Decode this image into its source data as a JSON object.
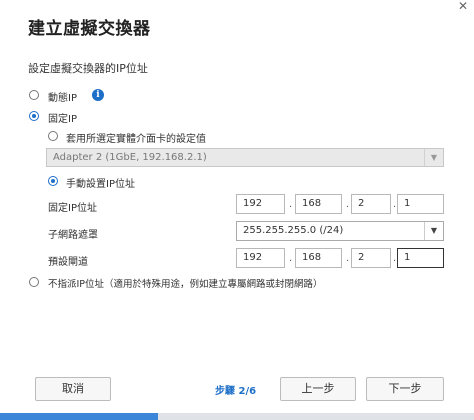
{
  "window": {
    "close_glyph": "✕"
  },
  "header": {
    "title": "建立虛擬交換器",
    "subtitle": "設定虛擬交換器的IP位址"
  },
  "options": {
    "dhcp": {
      "label": "動態IP",
      "info_glyph": "i",
      "checked": false
    },
    "static": {
      "label": "固定IP",
      "checked": true
    },
    "use_adapter": {
      "label": "套用所選定實體介面卡的設定值",
      "checked": false
    },
    "adapter_select": {
      "value": "Adapter 2 (1GbE, 192.168.2.1)",
      "disabled": true
    },
    "manual": {
      "label": "手動設置IP位址",
      "checked": true
    },
    "no_ip": {
      "label": "不指派IP位址（適用於特殊用途，例如建立專屬網路或封閉網路）",
      "checked": false
    }
  },
  "fields": {
    "static_ip": {
      "label": "固定IP位址",
      "octets": [
        "192",
        "168",
        "2",
        "1"
      ]
    },
    "subnet": {
      "label": "子網路遮罩",
      "value": "255.255.255.0 (/24)"
    },
    "gateway": {
      "label": "預設閘道",
      "octets": [
        "192",
        "168",
        "2",
        "1"
      ]
    }
  },
  "footer": {
    "cancel_label": "取消",
    "step_label": "步驟 2/6",
    "prev_label": "上一步",
    "next_label": "下一步"
  },
  "progress": {
    "fraction": 0.333
  },
  "icons": {
    "info": "info-icon",
    "dropdown": "chevron-down-icon",
    "close": "close-icon"
  },
  "colors": {
    "accent": "#1e6fc8",
    "progress": "#3b86d8"
  }
}
